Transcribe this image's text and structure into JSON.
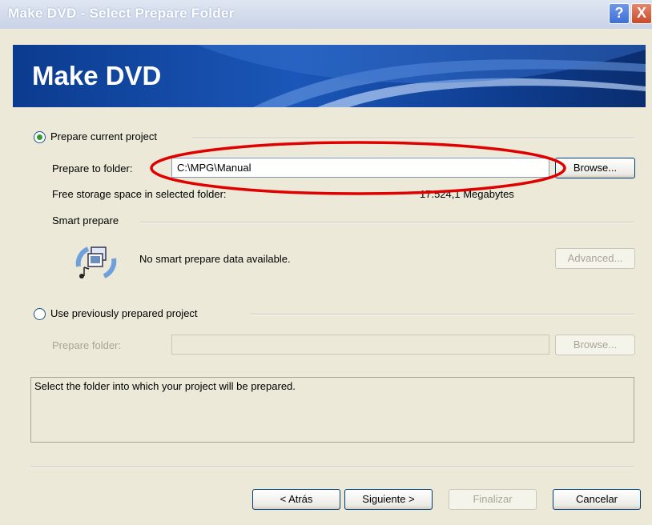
{
  "window": {
    "title": "Make DVD - Select Prepare Folder",
    "help_label": "?",
    "close_label": "X"
  },
  "banner": {
    "title": "Make DVD"
  },
  "prepare_current": {
    "label": "Prepare current project",
    "selected": true,
    "folder_label": "Prepare to folder:",
    "folder_value": "C:\\MPG\\Manual",
    "browse_label": "Browse...",
    "free_space_label": "Free storage space in selected folder:",
    "free_space_value": "17.524,1 Megabytes"
  },
  "smart_prepare": {
    "label": "Smart prepare",
    "message": "No smart prepare data available.",
    "advanced_label": "Advanced...",
    "icon": "smart-prepare-icon"
  },
  "use_previous": {
    "label": "Use previously prepared project",
    "selected": false,
    "folder_label": "Prepare folder:",
    "folder_value": "",
    "browse_label": "Browse..."
  },
  "info": {
    "text": "Select the folder into which your project will be prepared."
  },
  "footer": {
    "back_label": "< Atrás",
    "next_label": "Siguiente >",
    "finish_label": "Finalizar",
    "cancel_label": "Cancelar"
  },
  "colors": {
    "annotation": "#e00000",
    "banner": "#0b3b8f",
    "dialog_bg": "#ece9d8"
  }
}
